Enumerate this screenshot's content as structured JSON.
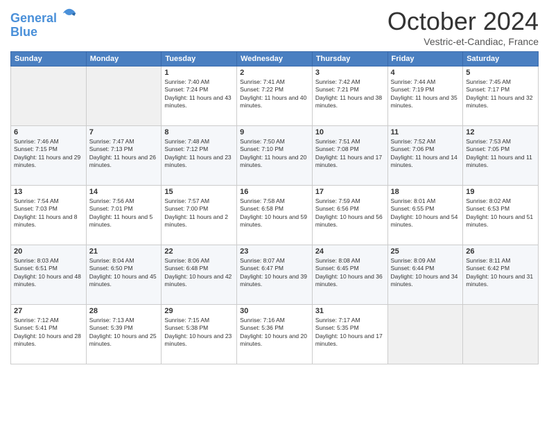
{
  "header": {
    "logo_line1": "General",
    "logo_line2": "Blue",
    "month": "October 2024",
    "location": "Vestric-et-Candiac, France"
  },
  "days_of_week": [
    "Sunday",
    "Monday",
    "Tuesday",
    "Wednesday",
    "Thursday",
    "Friday",
    "Saturday"
  ],
  "weeks": [
    [
      {
        "day": "",
        "info": ""
      },
      {
        "day": "",
        "info": ""
      },
      {
        "day": "1",
        "info": "Sunrise: 7:40 AM\nSunset: 7:24 PM\nDaylight: 11 hours and 43 minutes."
      },
      {
        "day": "2",
        "info": "Sunrise: 7:41 AM\nSunset: 7:22 PM\nDaylight: 11 hours and 40 minutes."
      },
      {
        "day": "3",
        "info": "Sunrise: 7:42 AM\nSunset: 7:21 PM\nDaylight: 11 hours and 38 minutes."
      },
      {
        "day": "4",
        "info": "Sunrise: 7:44 AM\nSunset: 7:19 PM\nDaylight: 11 hours and 35 minutes."
      },
      {
        "day": "5",
        "info": "Sunrise: 7:45 AM\nSunset: 7:17 PM\nDaylight: 11 hours and 32 minutes."
      }
    ],
    [
      {
        "day": "6",
        "info": "Sunrise: 7:46 AM\nSunset: 7:15 PM\nDaylight: 11 hours and 29 minutes."
      },
      {
        "day": "7",
        "info": "Sunrise: 7:47 AM\nSunset: 7:13 PM\nDaylight: 11 hours and 26 minutes."
      },
      {
        "day": "8",
        "info": "Sunrise: 7:48 AM\nSunset: 7:12 PM\nDaylight: 11 hours and 23 minutes."
      },
      {
        "day": "9",
        "info": "Sunrise: 7:50 AM\nSunset: 7:10 PM\nDaylight: 11 hours and 20 minutes."
      },
      {
        "day": "10",
        "info": "Sunrise: 7:51 AM\nSunset: 7:08 PM\nDaylight: 11 hours and 17 minutes."
      },
      {
        "day": "11",
        "info": "Sunrise: 7:52 AM\nSunset: 7:06 PM\nDaylight: 11 hours and 14 minutes."
      },
      {
        "day": "12",
        "info": "Sunrise: 7:53 AM\nSunset: 7:05 PM\nDaylight: 11 hours and 11 minutes."
      }
    ],
    [
      {
        "day": "13",
        "info": "Sunrise: 7:54 AM\nSunset: 7:03 PM\nDaylight: 11 hours and 8 minutes."
      },
      {
        "day": "14",
        "info": "Sunrise: 7:56 AM\nSunset: 7:01 PM\nDaylight: 11 hours and 5 minutes."
      },
      {
        "day": "15",
        "info": "Sunrise: 7:57 AM\nSunset: 7:00 PM\nDaylight: 11 hours and 2 minutes."
      },
      {
        "day": "16",
        "info": "Sunrise: 7:58 AM\nSunset: 6:58 PM\nDaylight: 10 hours and 59 minutes."
      },
      {
        "day": "17",
        "info": "Sunrise: 7:59 AM\nSunset: 6:56 PM\nDaylight: 10 hours and 56 minutes."
      },
      {
        "day": "18",
        "info": "Sunrise: 8:01 AM\nSunset: 6:55 PM\nDaylight: 10 hours and 54 minutes."
      },
      {
        "day": "19",
        "info": "Sunrise: 8:02 AM\nSunset: 6:53 PM\nDaylight: 10 hours and 51 minutes."
      }
    ],
    [
      {
        "day": "20",
        "info": "Sunrise: 8:03 AM\nSunset: 6:51 PM\nDaylight: 10 hours and 48 minutes."
      },
      {
        "day": "21",
        "info": "Sunrise: 8:04 AM\nSunset: 6:50 PM\nDaylight: 10 hours and 45 minutes."
      },
      {
        "day": "22",
        "info": "Sunrise: 8:06 AM\nSunset: 6:48 PM\nDaylight: 10 hours and 42 minutes."
      },
      {
        "day": "23",
        "info": "Sunrise: 8:07 AM\nSunset: 6:47 PM\nDaylight: 10 hours and 39 minutes."
      },
      {
        "day": "24",
        "info": "Sunrise: 8:08 AM\nSunset: 6:45 PM\nDaylight: 10 hours and 36 minutes."
      },
      {
        "day": "25",
        "info": "Sunrise: 8:09 AM\nSunset: 6:44 PM\nDaylight: 10 hours and 34 minutes."
      },
      {
        "day": "26",
        "info": "Sunrise: 8:11 AM\nSunset: 6:42 PM\nDaylight: 10 hours and 31 minutes."
      }
    ],
    [
      {
        "day": "27",
        "info": "Sunrise: 7:12 AM\nSunset: 5:41 PM\nDaylight: 10 hours and 28 minutes."
      },
      {
        "day": "28",
        "info": "Sunrise: 7:13 AM\nSunset: 5:39 PM\nDaylight: 10 hours and 25 minutes."
      },
      {
        "day": "29",
        "info": "Sunrise: 7:15 AM\nSunset: 5:38 PM\nDaylight: 10 hours and 23 minutes."
      },
      {
        "day": "30",
        "info": "Sunrise: 7:16 AM\nSunset: 5:36 PM\nDaylight: 10 hours and 20 minutes."
      },
      {
        "day": "31",
        "info": "Sunrise: 7:17 AM\nSunset: 5:35 PM\nDaylight: 10 hours and 17 minutes."
      },
      {
        "day": "",
        "info": ""
      },
      {
        "day": "",
        "info": ""
      }
    ]
  ]
}
